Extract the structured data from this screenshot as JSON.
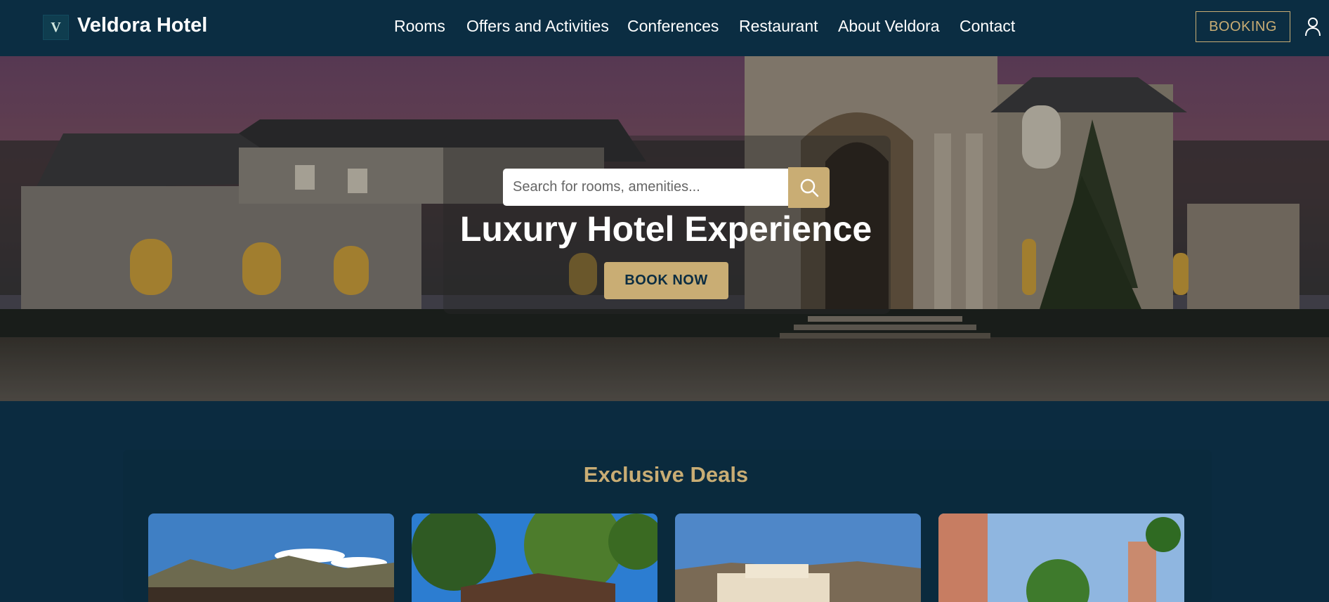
{
  "header": {
    "logo_letter": "V",
    "brand": "Veldora Hotel",
    "nav": [
      "Rooms",
      "Offers and Activities",
      "Conferences",
      "Restaurant",
      "About Veldora",
      "Contact"
    ],
    "booking_label": "BOOKING"
  },
  "hero": {
    "search_placeholder": "Search for rooms, amenities...",
    "title": "Luxury Hotel Experience",
    "cta_label": "BOOK NOW"
  },
  "deals": {
    "title": "Exclusive Deals"
  },
  "colors": {
    "navy": "#0b2d42",
    "gold": "#c9ad74"
  }
}
